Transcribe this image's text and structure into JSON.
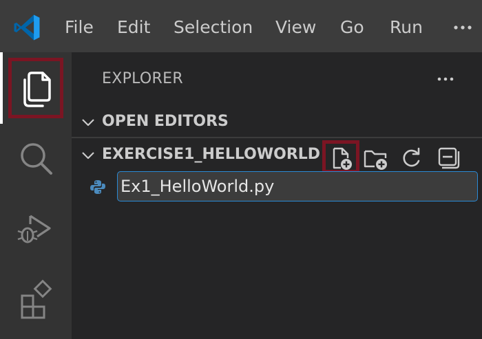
{
  "menu": {
    "items": [
      {
        "label": "File"
      },
      {
        "label": "Edit"
      },
      {
        "label": "Selection"
      },
      {
        "label": "View"
      },
      {
        "label": "Go"
      },
      {
        "label": "Run"
      }
    ],
    "more_label": "···"
  },
  "activitybar": {
    "items": [
      {
        "icon": "explorer-icon",
        "active": true
      },
      {
        "icon": "search-icon"
      },
      {
        "icon": "run-debug-icon"
      },
      {
        "icon": "extensions-icon"
      }
    ]
  },
  "sidebar": {
    "title": "EXPLORER",
    "sections": [
      {
        "label": "OPEN EDITORS",
        "expanded": true
      },
      {
        "label": "EXERCISE1_HELLOWORLD",
        "expanded": true
      }
    ],
    "toolbar": [
      {
        "icon": "new-file-icon",
        "highlighted": true
      },
      {
        "icon": "new-folder-icon"
      },
      {
        "icon": "refresh-icon"
      },
      {
        "icon": "collapse-all-icon"
      }
    ],
    "file_input": {
      "value": "Ex1_HelloWorld.py",
      "icon": "python-icon"
    }
  },
  "colors": {
    "titlebar": "#3c3c3c",
    "activitybar": "#333333",
    "sidebar": "#252526",
    "highlight": "#7b1523",
    "focus_border": "#2a8ad6",
    "python_blue": "#4b8bbe"
  }
}
